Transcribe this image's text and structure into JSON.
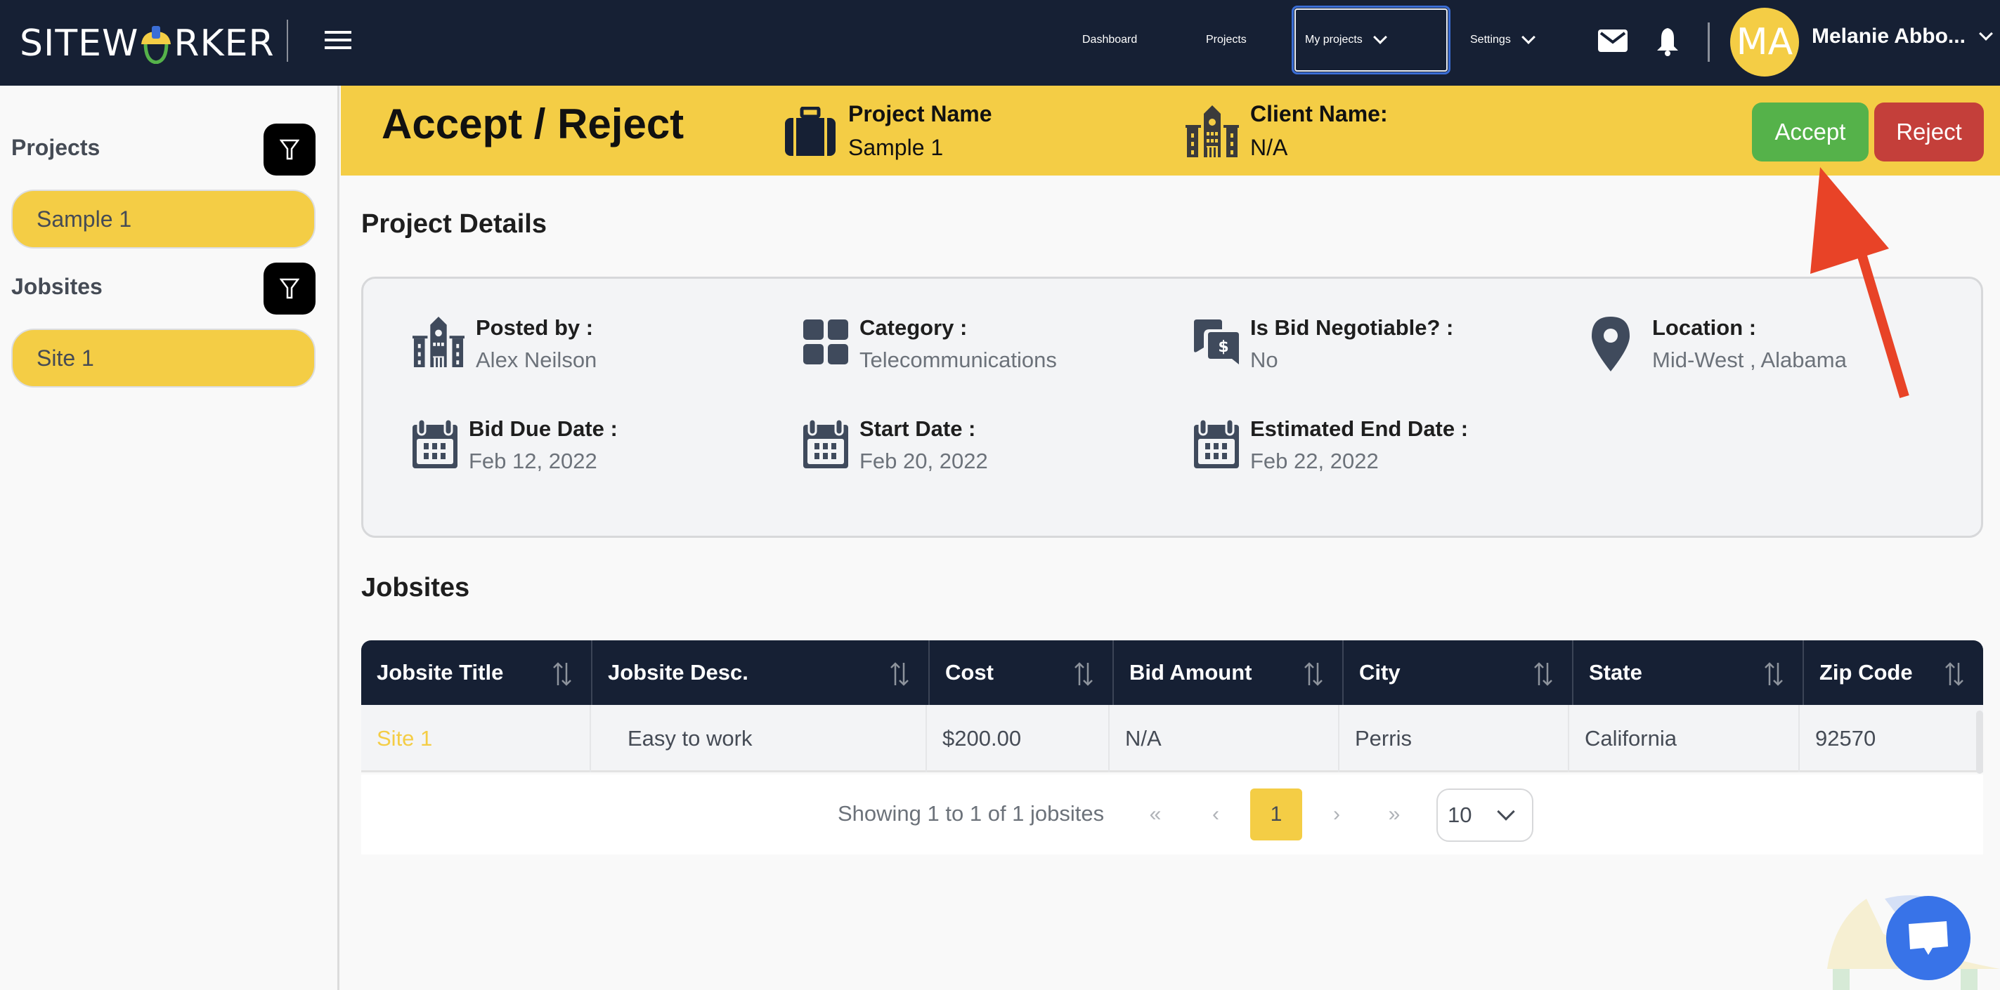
{
  "app": {
    "logo_text_left": "SITEW",
    "logo_text_right": "RKER"
  },
  "nav": {
    "items": [
      {
        "label": "Dashboard"
      },
      {
        "label": "Projects"
      },
      {
        "label": "My projects"
      },
      {
        "label": "Settings"
      }
    ],
    "icons": {
      "mail": "mail-icon",
      "notifications": "bell-icon"
    },
    "user": {
      "initials": "MA",
      "name": "Melanie Abbo..."
    }
  },
  "sidebar": {
    "projects_heading": "Projects",
    "projects": [
      {
        "label": "Sample 1"
      }
    ],
    "jobsites_heading": "Jobsites",
    "jobsites": [
      {
        "label": "Site 1"
      }
    ]
  },
  "header": {
    "title": "Accept / Reject",
    "project_name_label": "Project Name",
    "project_name_value": "Sample 1",
    "client_name_label": "Client Name:",
    "client_name_value": "N/A",
    "accept_label": "Accept",
    "reject_label": "Reject"
  },
  "details": {
    "title": "Project Details",
    "fields": [
      {
        "label": "Posted by :",
        "value": "Alex Neilson",
        "icon": "building-icon"
      },
      {
        "label": "Category :",
        "value": "Telecommunications",
        "icon": "grid-icon"
      },
      {
        "label": "Is Bid Negotiable? :",
        "value": "No",
        "icon": "bid-chat-icon"
      },
      {
        "label": "Location :",
        "value": "Mid-West , Alabama",
        "icon": "map-pin-icon"
      },
      {
        "label": "Bid Due Date :",
        "value": "Feb 12, 2022",
        "icon": "calendar-icon"
      },
      {
        "label": "Start Date :",
        "value": "Feb 20, 2022",
        "icon": "calendar-icon"
      },
      {
        "label": "Estimated End Date :",
        "value": "Feb 22, 2022",
        "icon": "calendar-icon"
      }
    ]
  },
  "jobsites": {
    "title": "Jobsites",
    "columns": [
      "Jobsite Title",
      "Jobsite Desc.",
      "Cost",
      "Bid Amount",
      "City",
      "State",
      "Zip Code"
    ],
    "rows": [
      [
        "Site 1",
        "Easy to work",
        "$200.00",
        "N/A",
        "Perris",
        "California",
        "92570"
      ]
    ],
    "pagination": {
      "summary": "Showing 1 to 1 of 1 jobsites",
      "first": "«",
      "prev": "‹",
      "current_page": "1",
      "next": "›",
      "last": "»",
      "page_size": "10"
    }
  },
  "colors": {
    "nav_bg": "#162034",
    "brand_yellow": "#f4cd45",
    "accept_green": "#55b24a",
    "reject_red": "#c43f3a",
    "annotation_arrow": "#e84327",
    "chat_blue": "#3873e8"
  }
}
